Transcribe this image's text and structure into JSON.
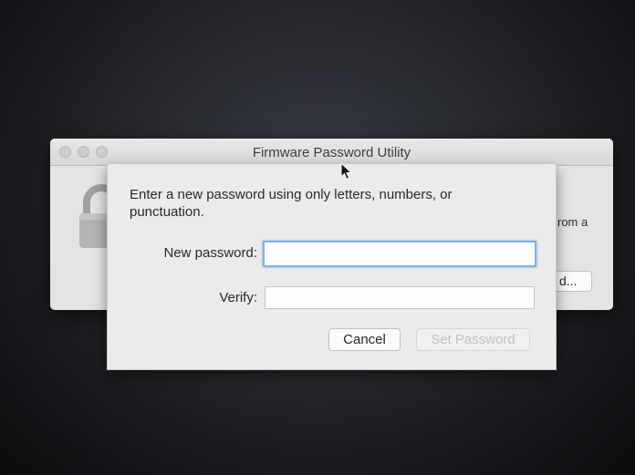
{
  "window": {
    "title": "Firmware Password Utility",
    "background_text": "rom a",
    "background_button_label": "d..."
  },
  "sheet": {
    "prompt": "Enter a new password using only letters, numbers, or punctuation.",
    "new_password": {
      "label": "New password:",
      "value": "",
      "placeholder": ""
    },
    "verify": {
      "label": "Verify:",
      "value": "",
      "placeholder": ""
    },
    "cancel_label": "Cancel",
    "set_password_label": "Set Password"
  },
  "colors": {
    "focus_ring": "#7eb4df",
    "disabled_text": "#c4c2c0"
  },
  "icons": [
    "lock-icon",
    "close-icon",
    "minimize-icon",
    "zoom-icon",
    "mouse-pointer-icon"
  ]
}
